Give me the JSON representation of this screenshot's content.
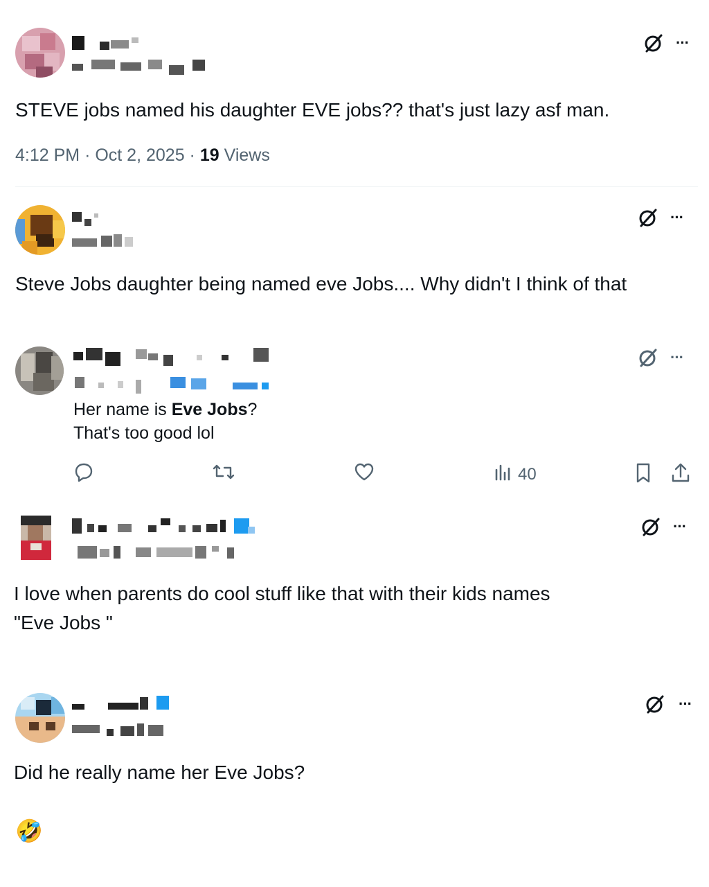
{
  "tweet_main": {
    "text": "STEVE jobs named his daughter EVE jobs??  that's just lazy asf man.",
    "time": "4:12 PM",
    "date": "Oct 2, 2025",
    "views_count": "19",
    "views_label": "Views",
    "sep1": "·",
    "sep2": "·"
  },
  "reply_1": {
    "text": "Steve Jobs daughter being named eve Jobs.... Why didn't I think of that"
  },
  "reply_2": {
    "line1_prefix": "Her name is ",
    "line1_bold": "Eve Jobs",
    "line1_suffix": "?",
    "line2": "That's too good lol",
    "views": "40"
  },
  "reply_3": {
    "line1": "I love when parents do cool stuff like that with their kids names",
    "line2": "\"Eve Jobs \""
  },
  "reply_4": {
    "line1": "Did he really name her Eve Jobs?",
    "emoji": "🤣"
  },
  "icons": {
    "grok": "grok-icon",
    "more": "more-icon",
    "reply": "reply-icon",
    "retweet": "retweet-icon",
    "like": "like-icon",
    "views": "views-icon",
    "bookmark": "bookmark-icon",
    "share": "share-icon"
  },
  "more_glyph": "···",
  "colors": {
    "text": "#0f1419",
    "secondary": "#536471",
    "divider": "#eff3f4",
    "verified": "#1d9bf0"
  }
}
